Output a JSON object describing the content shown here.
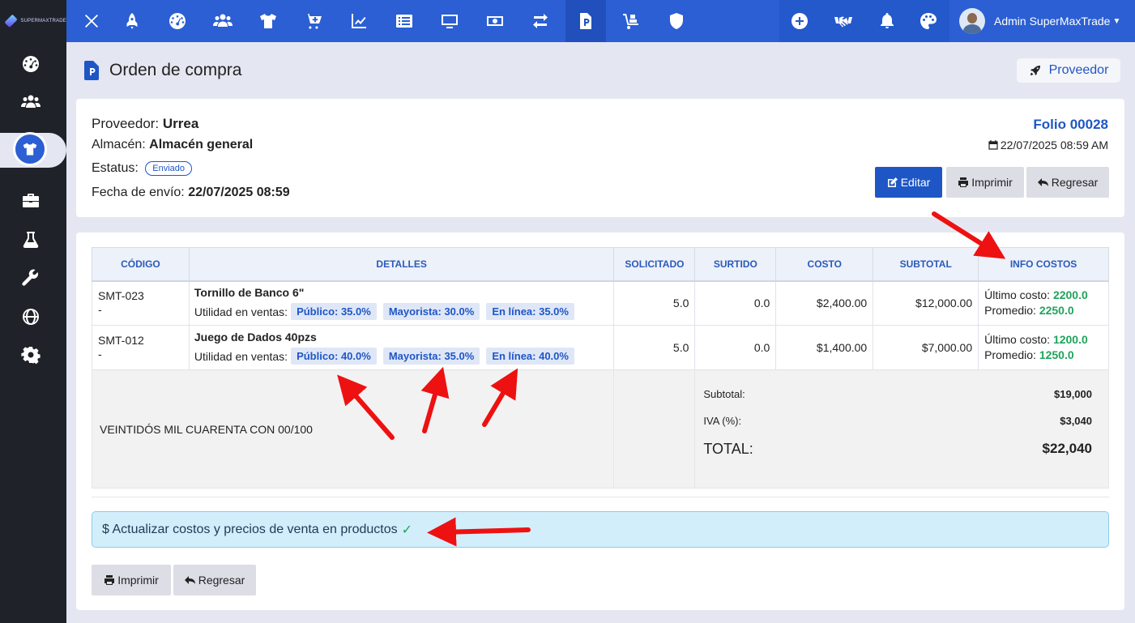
{
  "brand": {
    "name": "SUPERMAXTRADE"
  },
  "topbar": {
    "icons": [
      "close-icon",
      "rocket-icon",
      "dashboard-icon",
      "users-icon",
      "shirt-icon",
      "cart-plus-icon",
      "chart-line-icon",
      "list-icon",
      "monitor-icon",
      "money-icon",
      "exchange-icon",
      "purchase-order-icon",
      "dolly-icon",
      "shield-icon"
    ],
    "right_icons": [
      "plus-circle-icon",
      "handshake-icon",
      "bell-icon",
      "palette-icon"
    ],
    "user_name": "Admin SuperMaxTrade"
  },
  "sidebar": {
    "items": [
      "dashboard-icon",
      "users-icon",
      "shirt-icon",
      "briefcase-icon",
      "flask-icon",
      "wrench-icon",
      "globe-icon",
      "gear-icon"
    ],
    "active": "shirt-icon"
  },
  "page": {
    "title": "Orden de compra",
    "provider_button": "Proveedor"
  },
  "order": {
    "provider_label": "Proveedor:",
    "provider": "Urrea",
    "warehouse_label": "Almacén:",
    "warehouse": "Almacén general",
    "status_label": "Estatus:",
    "status": "Enviado",
    "sent_label": "Fecha de envío:",
    "sent_date": "22/07/2025 08:59",
    "folio": "Folio 00028",
    "date": "22/07/2025 08:59 AM",
    "edit_label": "Editar",
    "print_label": "Imprimir",
    "back_label": "Regresar"
  },
  "table": {
    "headers": [
      "CÓDIGO",
      "DETALLES",
      "SOLICITADO",
      "SURTIDO",
      "COSTO",
      "SUBTOTAL",
      "INFO COSTOS"
    ],
    "rows": [
      {
        "code": "SMT-023",
        "code_sub": "-",
        "name": "Tornillo de Banco 6\"",
        "util_label": "Utilidad en ventas:",
        "publico": "Público: 35.0%",
        "mayorista": "Mayorista: 30.0%",
        "linea": "En línea: 35.0%",
        "solicitado": "5.0",
        "surtido": "0.0",
        "costo": "$2,400.00",
        "subtotal": "$12,000.00",
        "ultimo_label": "Último costo:",
        "ultimo": "2200.0",
        "promedio_label": "Promedio:",
        "promedio": "2250.0"
      },
      {
        "code": "SMT-012",
        "code_sub": "-",
        "name": "Juego de Dados 40pzs",
        "util_label": "Utilidad en ventas:",
        "publico": "Público: 40.0%",
        "mayorista": "Mayorista: 35.0%",
        "linea": "En línea: 40.0%",
        "solicitado": "5.0",
        "surtido": "0.0",
        "costo": "$1,400.00",
        "subtotal": "$7,000.00",
        "ultimo_label": "Último costo:",
        "ultimo": "1200.0",
        "promedio_label": "Promedio:",
        "promedio": "1250.0"
      }
    ],
    "amount_words": "VEINTIDÓS MIL CUARENTA CON 00/100",
    "subtotal_label": "Subtotal:",
    "subtotal": "$19,000",
    "iva_label": "IVA (%):",
    "iva": "$3,040",
    "total_label": "TOTAL:",
    "total": "$22,040"
  },
  "alert": {
    "text": "$ Actualizar costos y precios de venta en productos",
    "check": "✓"
  },
  "footer": {
    "print_label": "Imprimir",
    "back_label": "Regresar"
  },
  "colors": {
    "primary": "#2b5fd3",
    "sidebar": "#1f2229",
    "accent_green": "#1fa45a",
    "annotation_red": "#ee1111"
  }
}
